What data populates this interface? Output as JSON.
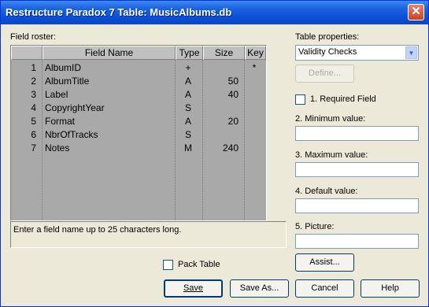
{
  "window": {
    "title": "Restructure Paradox 7 Table: MusicAlbums.db",
    "close_symbol": "✕"
  },
  "field_roster": {
    "label": "Field roster:",
    "columns": [
      "",
      "Field Name",
      "Type",
      "Size",
      "Key"
    ],
    "rows": [
      {
        "num": "1",
        "name": "AlbumID",
        "type": "+",
        "size": "",
        "key": "*"
      },
      {
        "num": "2",
        "name": "AlbumTitle",
        "type": "A",
        "size": "50",
        "key": ""
      },
      {
        "num": "3",
        "name": "Label",
        "type": "A",
        "size": "40",
        "key": ""
      },
      {
        "num": "4",
        "name": "CopyrightYear",
        "type": "S",
        "size": "",
        "key": ""
      },
      {
        "num": "5",
        "name": "Format",
        "type": "A",
        "size": "20",
        "key": ""
      },
      {
        "num": "6",
        "name": "NbrOfTracks",
        "type": "S",
        "size": "",
        "key": ""
      },
      {
        "num": "7",
        "name": "Notes",
        "type": "M",
        "size": "240",
        "key": ""
      }
    ]
  },
  "status_text": "Enter a field name up to 25 characters long.",
  "table_properties": {
    "label": "Table properties:",
    "selected": "Validity Checks",
    "define_button": "Define...",
    "required_field": "1. Required Field",
    "min_label": "2. Minimum value:",
    "max_label": "3. Maximum value:",
    "default_label": "4. Default value:",
    "picture_label": "5. Picture:",
    "min_value": "",
    "max_value": "",
    "default_value": "",
    "picture_value": "",
    "assist_button": "Assist..."
  },
  "pack_table": {
    "label": "Pack Table",
    "checked": false
  },
  "buttons": {
    "save": "Save",
    "save_as": "Save As...",
    "cancel": "Cancel",
    "help": "Help"
  }
}
